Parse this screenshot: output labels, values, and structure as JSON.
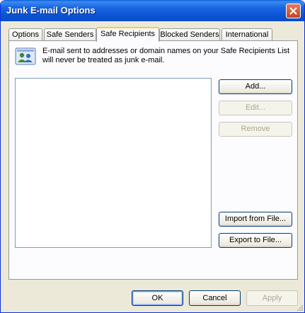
{
  "window": {
    "title": "Junk E-mail Options"
  },
  "tabs": [
    {
      "label": "Options"
    },
    {
      "label": "Safe Senders"
    },
    {
      "label": "Safe Recipients"
    },
    {
      "label": "Blocked Senders"
    },
    {
      "label": "International"
    }
  ],
  "active_tab": "Safe Recipients",
  "panel": {
    "info_text": "E-mail sent to addresses or domain names on your Safe Recipients List will never be treated as junk e-mail.",
    "list_items": []
  },
  "side_buttons": {
    "add": "Add...",
    "edit": "Edit...",
    "remove": "Remove",
    "import": "Import from File...",
    "export": "Export to File..."
  },
  "dialog_buttons": {
    "ok": "OK",
    "cancel": "Cancel",
    "apply": "Apply"
  },
  "colors": {
    "titlebar": "#0b55d4",
    "dialog_face": "#ece9d8",
    "active_tab_accent": "#ffc83c",
    "disabled_text": "#aca899"
  },
  "icons": {
    "close": "close-icon",
    "info": "contacts-icon"
  }
}
